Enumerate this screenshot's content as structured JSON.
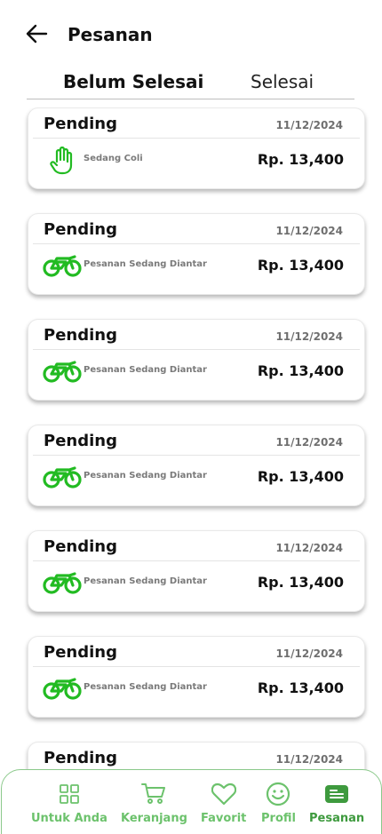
{
  "header": {
    "title": "Pesanan",
    "back_icon": "arrow-left-icon"
  },
  "tabs": [
    {
      "label": "Belum Selesai",
      "active": true
    },
    {
      "label": "Selesai",
      "active": false
    }
  ],
  "orders": [
    {
      "status": "Pending",
      "date": "11/12/2024",
      "description": "Sedang Coli",
      "price": "Rp. 13,400",
      "icon": "hand-icon"
    },
    {
      "status": "Pending",
      "date": "11/12/2024",
      "description": "Pesanan Sedang Diantar",
      "price": "Rp. 13,400",
      "icon": "bike-icon"
    },
    {
      "status": "Pending",
      "date": "11/12/2024",
      "description": "Pesanan Sedang Diantar",
      "price": "Rp. 13,400",
      "icon": "bike-icon"
    },
    {
      "status": "Pending",
      "date": "11/12/2024",
      "description": "Pesanan Sedang Diantar",
      "price": "Rp. 13,400",
      "icon": "bike-icon"
    },
    {
      "status": "Pending",
      "date": "11/12/2024",
      "description": "Pesanan Sedang Diantar",
      "price": "Rp. 13,400",
      "icon": "bike-icon"
    },
    {
      "status": "Pending",
      "date": "11/12/2024",
      "description": "Pesanan Sedang Diantar",
      "price": "Rp. 13,400",
      "icon": "bike-icon"
    },
    {
      "status": "Pending",
      "date": "11/12/2024"
    }
  ],
  "nav": [
    {
      "label": "Untuk Anda",
      "icon": "grid-icon",
      "active": false
    },
    {
      "label": "Keranjang",
      "icon": "cart-icon",
      "active": false
    },
    {
      "label": "Favorit",
      "icon": "heart-icon",
      "active": false
    },
    {
      "label": "Profil",
      "icon": "smile-icon",
      "active": false
    },
    {
      "label": "Pesanan",
      "icon": "orders-icon",
      "active": true
    }
  ],
  "colors": {
    "accent": "#22bb22",
    "nav_label": "#6cc26c",
    "nav_active": "#3e9a3e",
    "nav_border": "#8bc98b"
  }
}
